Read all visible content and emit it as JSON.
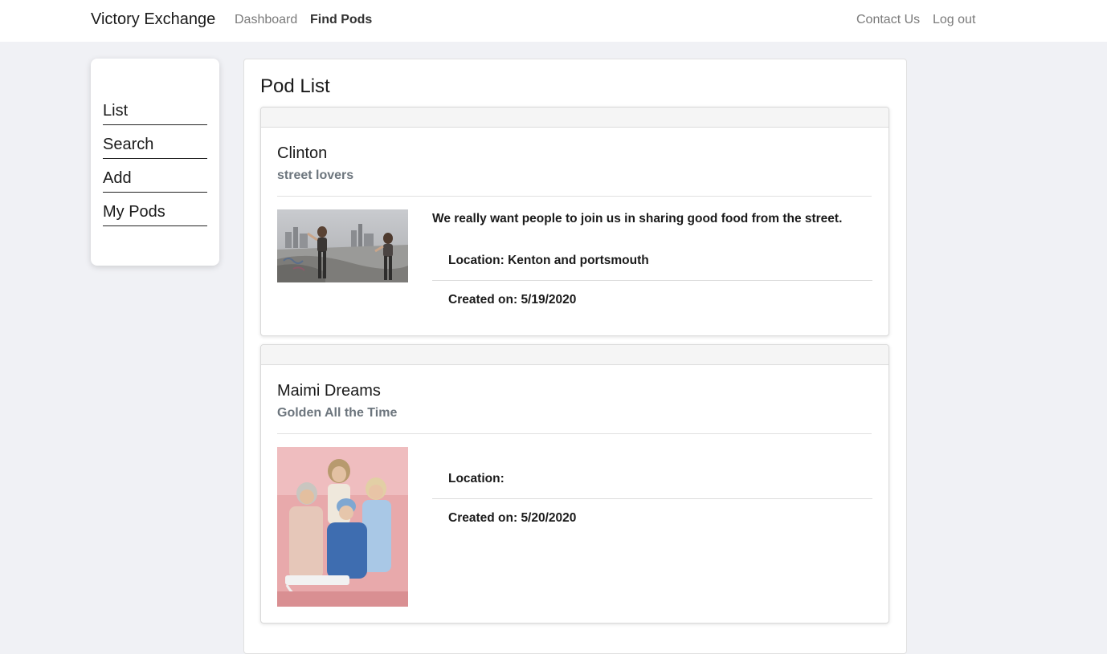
{
  "navbar": {
    "brand": "Victory Exchange",
    "links": {
      "dashboard": "Dashboard",
      "find_pods": "Find Pods",
      "contact_us": "Contact Us",
      "log_out": "Log out"
    }
  },
  "sidebar": {
    "items": [
      {
        "label": "List"
      },
      {
        "label": "Search"
      },
      {
        "label": "Add"
      },
      {
        "label": "My Pods"
      }
    ]
  },
  "main": {
    "title": "Pod List",
    "pods": [
      {
        "name": "Clinton",
        "subtitle": "street lovers",
        "description": "We really want people to join us in sharing good food from the street.",
        "location_label": "Location:",
        "location": "Kenton and portsmouth",
        "created_label": "Created on:",
        "created": "5/19/2020"
      },
      {
        "name": "Maimi Dreams",
        "subtitle": "Golden All the Time",
        "description": "",
        "location_label": "Location:",
        "location": "",
        "created_label": "Created on:",
        "created": "5/20/2020"
      }
    ]
  },
  "colors": {
    "background": "#f0f1f5",
    "subtitle": "#6c757d",
    "nav_inactive": "#7a7a7a"
  }
}
